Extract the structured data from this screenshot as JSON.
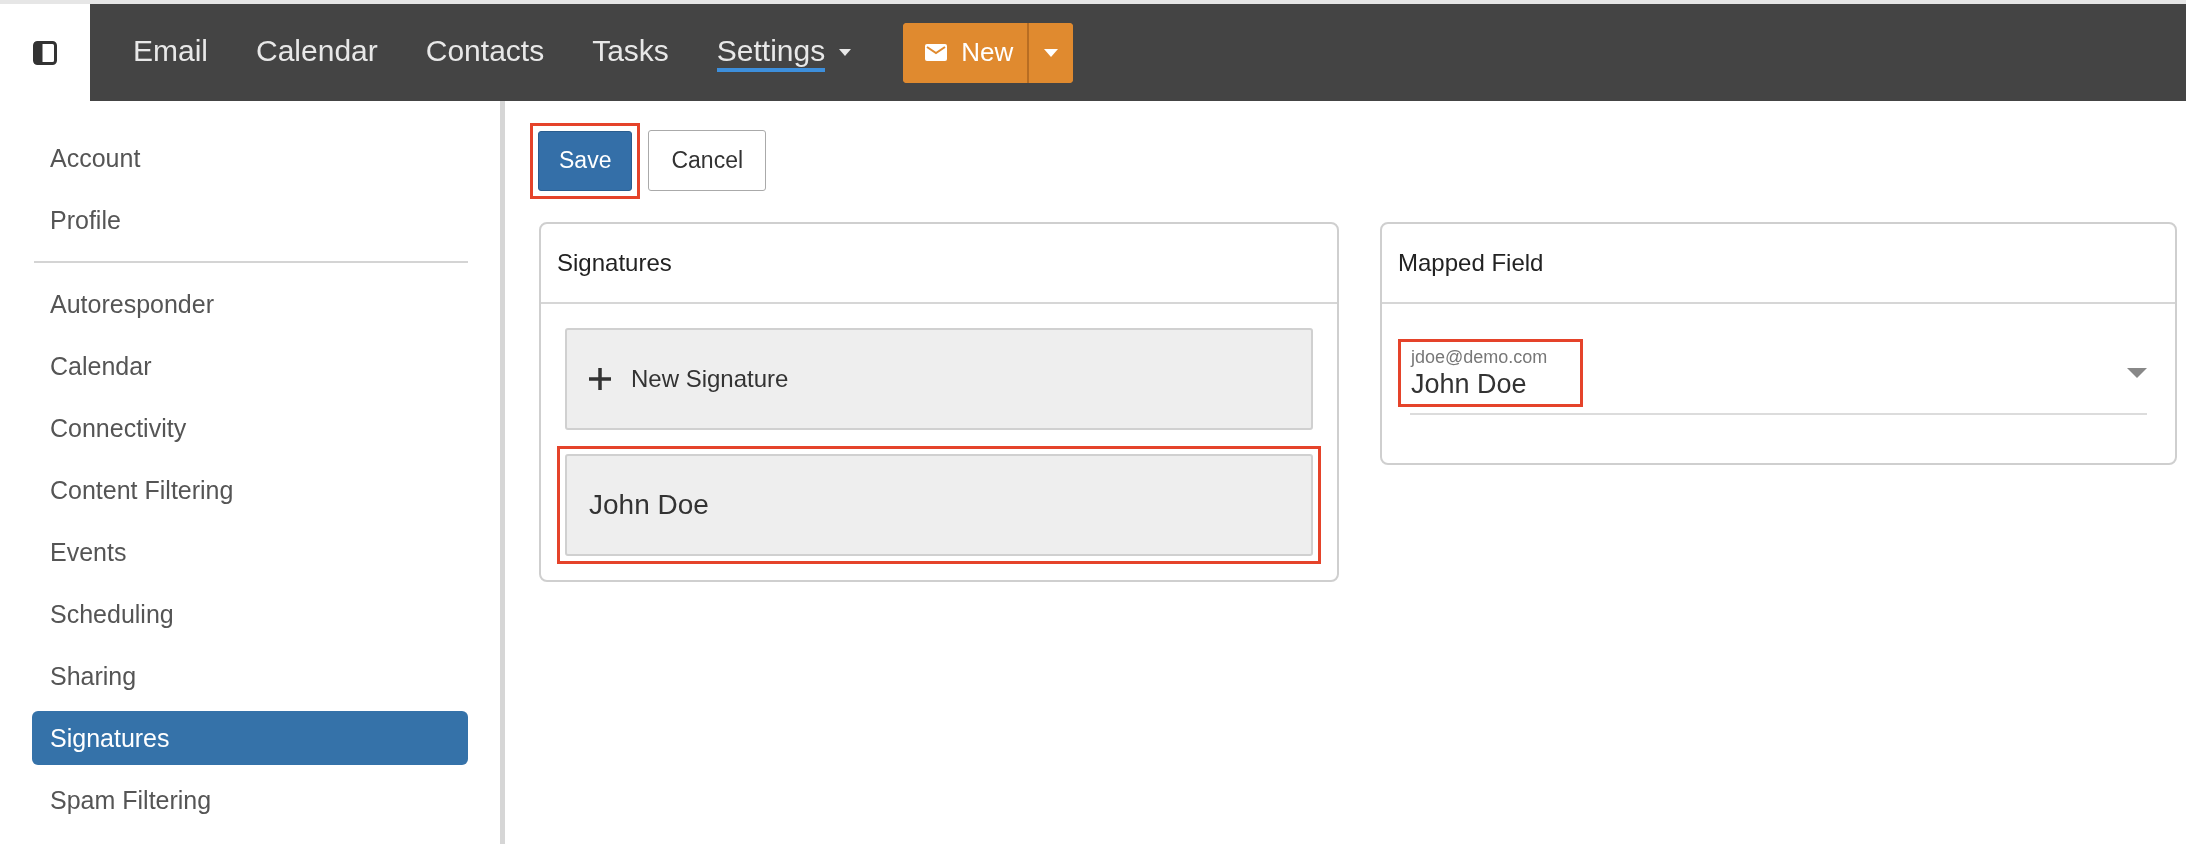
{
  "app_bar": {
    "nav": [
      {
        "label": "Email",
        "selected": false,
        "has_menu": false
      },
      {
        "label": "Calendar",
        "selected": false,
        "has_menu": false
      },
      {
        "label": "Contacts",
        "selected": false,
        "has_menu": false
      },
      {
        "label": "Tasks",
        "selected": false,
        "has_menu": false
      },
      {
        "label": "Settings",
        "selected": true,
        "has_menu": true
      }
    ],
    "new_button": {
      "label": "New"
    }
  },
  "sidebar": {
    "groups": [
      {
        "items": [
          {
            "label": "Account",
            "selected": false
          },
          {
            "label": "Profile",
            "selected": false
          }
        ]
      },
      {
        "items": [
          {
            "label": "Autoresponder",
            "selected": false
          },
          {
            "label": "Calendar",
            "selected": false
          },
          {
            "label": "Connectivity",
            "selected": false
          },
          {
            "label": "Content Filtering",
            "selected": false
          },
          {
            "label": "Events",
            "selected": false
          },
          {
            "label": "Scheduling",
            "selected": false
          },
          {
            "label": "Sharing",
            "selected": false
          },
          {
            "label": "Signatures",
            "selected": true
          },
          {
            "label": "Spam Filtering",
            "selected": false
          }
        ]
      }
    ]
  },
  "toolbar": {
    "buttons": [
      {
        "label": "Save",
        "kind": "primary",
        "annotated": true
      },
      {
        "label": "Cancel",
        "kind": "default",
        "annotated": false
      }
    ]
  },
  "signatures_panel": {
    "title": "Signatures",
    "new_button": {
      "label": "New Signature"
    },
    "items": [
      {
        "label": "John Doe",
        "annotated": true
      }
    ]
  },
  "mapped_field_panel": {
    "title": "Mapped Field",
    "field": {
      "label": "jdoe@demo.com",
      "value": "John Doe",
      "annotated": true
    }
  }
}
